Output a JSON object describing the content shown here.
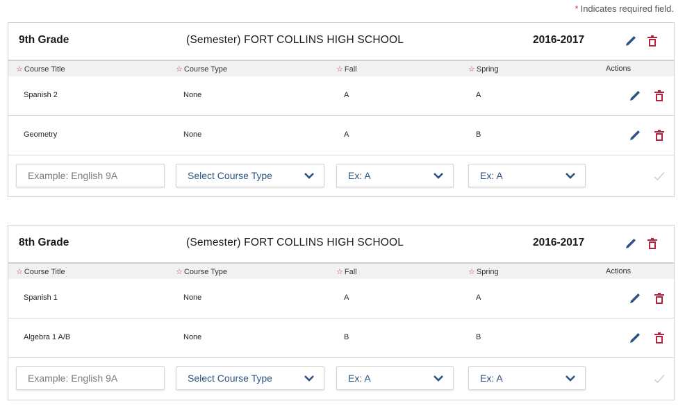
{
  "required_note": {
    "star": "*",
    "text": "Indicates required field."
  },
  "colors": {
    "accent_blue": "#2c5282",
    "delete_red": "#b0243f",
    "required_star": "#c0394b"
  },
  "columns": {
    "course_title": "Course Title",
    "course_type": "Course Type",
    "fall": "Fall",
    "spring": "Spring",
    "actions": "Actions"
  },
  "panels": [
    {
      "grade": "9th Grade",
      "school": "(Semester) FORT COLLINS HIGH SCHOOL",
      "year": "2016-2017",
      "courses": [
        {
          "title": "Spanish 2",
          "type": "None",
          "fall": "A",
          "spring": "A"
        },
        {
          "title": "Geometry",
          "type": "None",
          "fall": "A",
          "spring": "B"
        }
      ],
      "new_course": {
        "title_placeholder": "Example: English 9A",
        "type_placeholder": "Select Course Type",
        "fall_placeholder": "Ex: A",
        "spring_placeholder": "Ex: A"
      }
    },
    {
      "grade": "8th Grade",
      "school": "(Semester) FORT COLLINS HIGH SCHOOL",
      "year": "2016-2017",
      "courses": [
        {
          "title": "Spanish 1",
          "type": "None",
          "fall": "A",
          "spring": "A"
        },
        {
          "title": "Algebra 1 A/B",
          "type": "None",
          "fall": "B",
          "spring": "B"
        }
      ],
      "new_course": {
        "title_placeholder": "Example: English 9A",
        "type_placeholder": "Select Course Type",
        "fall_placeholder": "Ex: A",
        "spring_placeholder": "Ex: A"
      }
    }
  ]
}
